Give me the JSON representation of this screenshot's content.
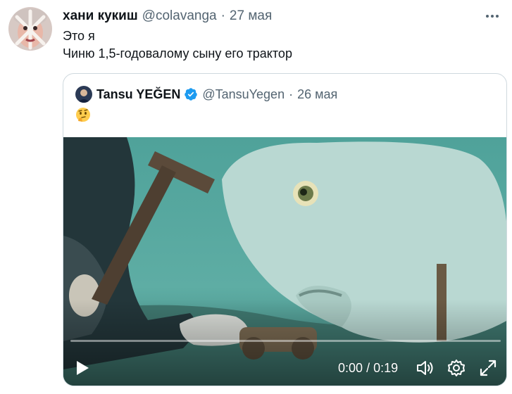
{
  "tweet": {
    "author_name": "хани кукиш",
    "author_handle": "@colavanga",
    "separator": "·",
    "time": "27 мая",
    "text_line1": "Это я",
    "text_line2": "Чиню 1,5-годовалому сыну его трактор"
  },
  "quoted_tweet": {
    "author_name": "Tansu YEĞEN",
    "author_handle": "@TansuYegen",
    "separator": "·",
    "time": "26 мая",
    "emoji": "🤔",
    "verified_color": "#1d9bf0"
  },
  "video": {
    "current_time": "0:00",
    "time_separator": "/",
    "duration": "0:19",
    "progress": 0.0
  },
  "icons": {
    "more": "more-icon",
    "verified": "verified-badge-icon",
    "play": "play-icon",
    "volume": "volume-icon",
    "settings": "settings-gear-icon",
    "fullscreen": "fullscreen-icon"
  },
  "colors": {
    "text_primary": "#0f1419",
    "text_secondary": "#536471",
    "border": "#cfd9de",
    "water": "#5fa8a0"
  }
}
